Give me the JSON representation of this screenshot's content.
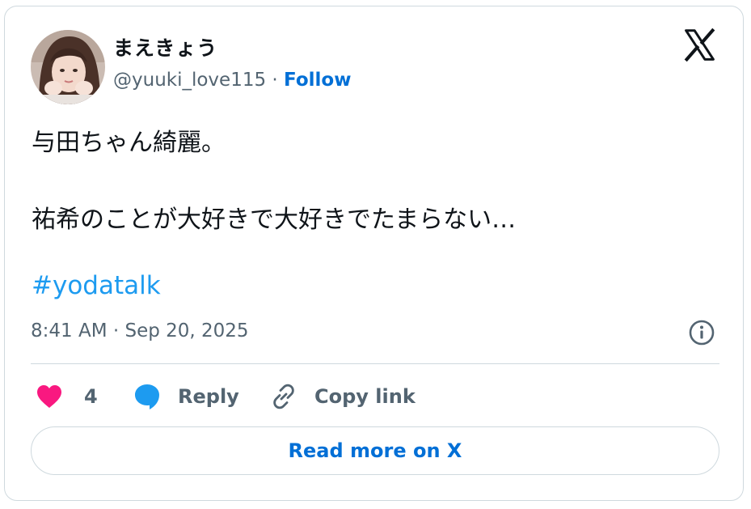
{
  "author": {
    "display_name": "まえきょう",
    "handle": "@yuuki_love115",
    "separator": " · ",
    "follow_label": "Follow"
  },
  "tweet": {
    "line1": "与田ちゃん綺麗。",
    "line2": "祐希のことが大好きで大好きでたまらない…",
    "hashtag": "#yodatalk",
    "timestamp": "8:41 AM · Sep 20, 2025"
  },
  "actions": {
    "like_count": "4",
    "reply_label": "Reply",
    "copy_link_label": "Copy link"
  },
  "read_more_label": "Read more on X",
  "icons": {
    "logo": "x-logo-icon",
    "info": "info-icon",
    "like": "heart-icon",
    "reply": "speech-bubble-icon",
    "copy": "link-icon"
  },
  "colors": {
    "link_blue": "#006fd6",
    "hashtag_blue": "#1d9bf0",
    "heart_pink": "#f91880",
    "reply_blue": "#1d9bf0",
    "muted_gray": "#536471",
    "text_dark": "#0f1419",
    "border": "#cfd9de"
  }
}
